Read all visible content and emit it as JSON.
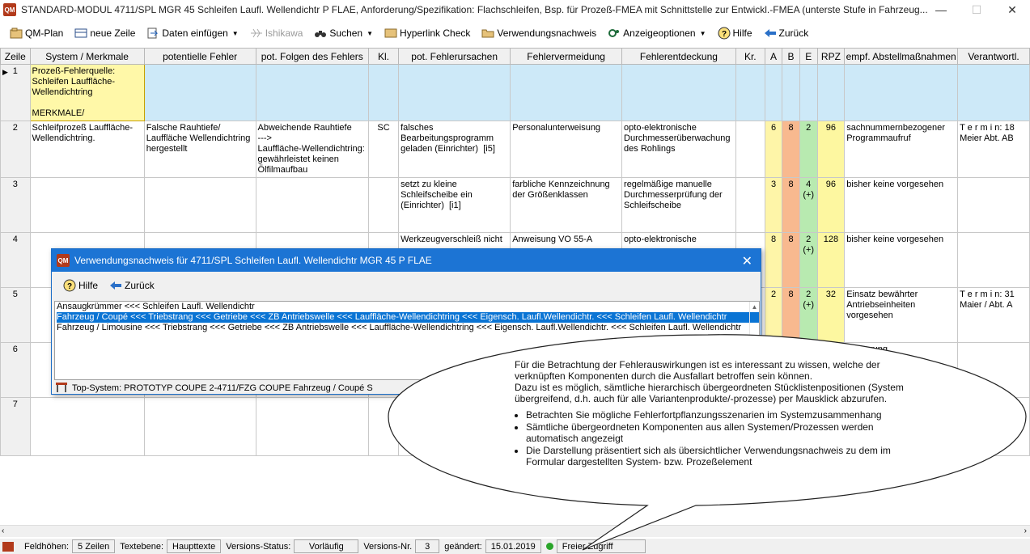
{
  "window": {
    "title": "STANDARD-MODUL  4711/SPL  MGR 45  Schleifen Laufl. Wellendichtr  P  FLAE,  Anforderung/Spezifikation: Flachschleifen, Bsp. für Prozeß-FMEA mit Schnittstelle zur Entwickl.-FMEA (unterste Stufe in Fahrzeug...",
    "icon_text": "QM",
    "minimize": "—",
    "maximize": "☐",
    "close": "✕"
  },
  "toolbar": {
    "qm_plan": "QM-Plan",
    "neue_zeile": "neue Zeile",
    "daten_einfuegen": "Daten einfügen",
    "ishikawa": "Ishikawa",
    "suchen": "Suchen",
    "hyperlink_check": "Hyperlink Check",
    "verwendungsnachweis": "Verwendungsnachweis",
    "anzeigeoptionen": "Anzeigeoptionen",
    "hilfe": "Hilfe",
    "zurueck": "Zurück"
  },
  "grid": {
    "headers": [
      "Zeile",
      "System / Merkmale",
      "potentielle Fehler",
      "pot. Folgen des Fehlers",
      "Kl.",
      "pot. Fehlerursachen",
      "Fehlervermeidung",
      "Fehlerentdeckung",
      "Kr.",
      "A",
      "B",
      "E",
      "RPZ",
      "empf. Abstellmaßnahmen",
      "Verantwortl."
    ],
    "rows": [
      {
        "zeile": "1",
        "system": "Prozeß-Fehlerquelle:\nSchleifen Lauffläche-Wellendichtring\n\nMERKMALE/",
        "fehler": "",
        "folgen": "",
        "kl": "",
        "ursachen": "",
        "vermeidung": "",
        "entdeckung": "",
        "kr": "",
        "a": "",
        "b": "",
        "e": "",
        "rpz": "",
        "massnahmen": "",
        "verantw": ""
      },
      {
        "zeile": "2",
        "system": "Schleifprozeß Lauffläche-Wellendichtring.",
        "fehler": "Falsche Rauhtiefe/ Lauffläche Wellendichtring hergestellt",
        "folgen": "Abweichende Rauhtiefe\n--->\nLauffläche-Wellendichtring: gewährleistet keinen Ölfilmaufbau",
        "kl": "SC",
        "ursachen": "falsches Bearbeitungsprogramm geladen (Einrichter)  [i5]",
        "vermeidung": "Personalunterweisung",
        "entdeckung": "opto-elektronische Durchmesserüberwachung des Rohlings",
        "kr": "",
        "a": "6",
        "b": "8",
        "e": "2",
        "rpz": "96",
        "massnahmen": "sachnummernbezogener Programmaufruf",
        "verantw": "T e r m i n: 18\nMeier Abt. AB"
      },
      {
        "zeile": "3",
        "system": "",
        "fehler": "",
        "folgen": "",
        "kl": "",
        "ursachen": "setzt zu kleine Schleifscheibe ein (Einrichter)  [i1]",
        "vermeidung": "farbliche Kennzeichnung der Größenklassen",
        "entdeckung": "regelmäßige manuelle Durchmesserprüfung der Schleifscheibe",
        "kr": "",
        "a": "3",
        "b": "8",
        "e": "4\n(+)",
        "rpz": "96",
        "massnahmen": "bisher keine vorgesehen",
        "verantw": ""
      },
      {
        "zeile": "4",
        "system": "",
        "fehler": "",
        "folgen": "",
        "kl": "",
        "ursachen": "Werkzeugverschleiß nicht",
        "vermeidung": "Anweisung VO 55-A",
        "entdeckung": "opto-elektronische",
        "kr": "",
        "a": "8",
        "b": "8",
        "e": "2\n(+)",
        "rpz": "128",
        "massnahmen": "bisher keine vorgesehen",
        "verantw": ""
      },
      {
        "zeile": "5",
        "system": "",
        "fehler": "",
        "folgen": "",
        "kl": "",
        "ursachen": "",
        "vermeidung": "",
        "entdeckung": "",
        "kr": "",
        "a": "2",
        "b": "8",
        "e": "2\n(+)",
        "rpz": "32",
        "massnahmen": "Einsatz bewährter Antriebseinheiten vorgesehen",
        "verantw": "T e r m i n: 31\nMaier / Abt. A"
      },
      {
        "zeile": "6",
        "system": "",
        "fehler": "",
        "folgen": "",
        "kl": "",
        "ursachen": "",
        "vermeidung": "",
        "entdeckung": "",
        "kr": "",
        "a": "",
        "b": "",
        "e": "",
        "rpz": "",
        "massnahmen": "Steuerung",
        "verantw": ""
      },
      {
        "zeile": "7",
        "system": "",
        "fehler": "",
        "folgen": "",
        "kl": "",
        "ursachen": "",
        "vermeidung": "",
        "entdeckung": "",
        "kr": "",
        "a": "",
        "b": "",
        "e": "",
        "rpz": "",
        "massnahmen": "",
        "verantw": ""
      }
    ]
  },
  "dialog": {
    "title": "Verwendungsnachweis für 4711/SPL Schleifen Laufl. Wellendichtr MGR 45 P FLAE",
    "hilfe": "Hilfe",
    "zurueck": "Zurück",
    "items": [
      "Ansaugkrümmer <<< Schleifen Laufl. Wellendichtr",
      "Fahrzeug / Coupé <<< Triebstrang <<< Getriebe <<< ZB Antriebswelle <<< Lauffläche-Wellendichtring <<< Eigensch. Laufl.Wellendichtr. <<< Schleifen Laufl. Wellendichtr",
      "Fahrzeug / Limousine <<< Triebstrang <<< Getriebe <<< ZB Antriebswelle <<< Lauffläche-Wellendichtring <<< Eigensch. Laufl.Wellendichtr. <<< Schleifen Laufl. Wellendichtr"
    ],
    "selected_index": 1,
    "top_system": "Top-System: PROTOTYP COUPE  2-4711/FZG  COUPE  Fahrzeug / Coupé  S"
  },
  "callout": {
    "paragraph1": "Für die Betrachtung der Fehlerauswirkungen ist es interessant zu wissen, welche der verknüpften Komponenten durch die Ausfallart betroffen sein können.",
    "paragraph2": "Dazu ist es möglich, sämtliche hierarchisch übergeordneten Stücklistenpositionen (System übergreifend, d.h. auch für alle Variantenprodukte/-prozesse) per Mausklick abzurufen.",
    "bullets": [
      "Betrachten Sie mögliche Fehlerfortpflanzungsszenarien im Systemzusammenhang",
      "Sämtliche übergeordneten Komponenten aus allen Systemen/Prozessen werden automatisch angezeigt",
      "Die Darstellung präsentiert sich als übersichtlicher Verwendungsnachweis zu dem im Formular dargestellten System- bzw. Prozeßelement"
    ]
  },
  "statusbar": {
    "feldhoehen_label": "Feldhöhen:",
    "feldhoehen_value": "5 Zeilen",
    "textebene_label": "Textebene:",
    "textebene_value": "Haupttexte",
    "versions_status_label": "Versions-Status:",
    "versions_status_value": "Vorläufig",
    "versions_nr_label": "Versions-Nr.",
    "versions_nr_value": "3",
    "geaendert_label": "geändert:",
    "geaendert_value": "15.01.2019",
    "zugriff": "Freier Zugriff"
  },
  "colors": {
    "titlebar_dialog": "#1c74d4",
    "selection": "#0a74d4",
    "row1_bg": "#cde9f8",
    "col_a": "#fef5a8",
    "col_b": "#f8b98f",
    "col_e": "#b8eab0",
    "status_dot": "#2aa52a"
  }
}
